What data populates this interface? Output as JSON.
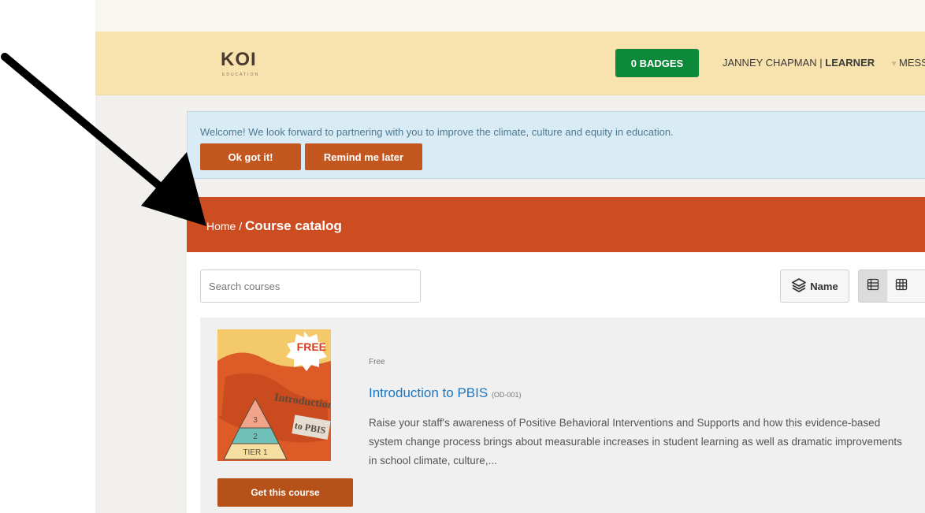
{
  "header": {
    "logo_text": "KOI",
    "logo_subtext": "EDUCATION",
    "badges_label": "0 BADGES",
    "user_name": "JANNEY CHAPMAN",
    "user_separator": " | ",
    "user_role": "LEARNER",
    "messages_label": "MESS"
  },
  "welcome": {
    "message": "Welcome! We look forward to partnering with you to improve the climate, culture and equity in education.",
    "ok_label": "Ok got it!",
    "remind_label": "Remind me later"
  },
  "breadcrumb": {
    "home": "Home",
    "separator": " / ",
    "current": "Course catalog"
  },
  "toolbar": {
    "search_placeholder": "Search courses",
    "sort_label": "Name"
  },
  "course": {
    "price": "Free",
    "title": "Introduction to PBIS",
    "code": "(OD-001)",
    "description": "Raise your staff's awareness of Positive Behavioral Interventions and Supports and how this evidence-based system change process brings about measurable increases in student learning as well as dramatic improvements in school climate, culture,...",
    "cta_label": "Get this course",
    "thumbnail": {
      "badge": "FREE",
      "line1": "Introduction",
      "line2": "to PBIS",
      "tiers": [
        "3",
        "2",
        "TIER 1"
      ]
    }
  },
  "colors": {
    "navbar": "#f8e2ad",
    "badges_green": "#0c8a3a",
    "accent_orange": "#cd4d23",
    "button_brown": "#c4561f",
    "link_blue": "#1b77c4",
    "welcome_bg": "#d9ebf4"
  }
}
